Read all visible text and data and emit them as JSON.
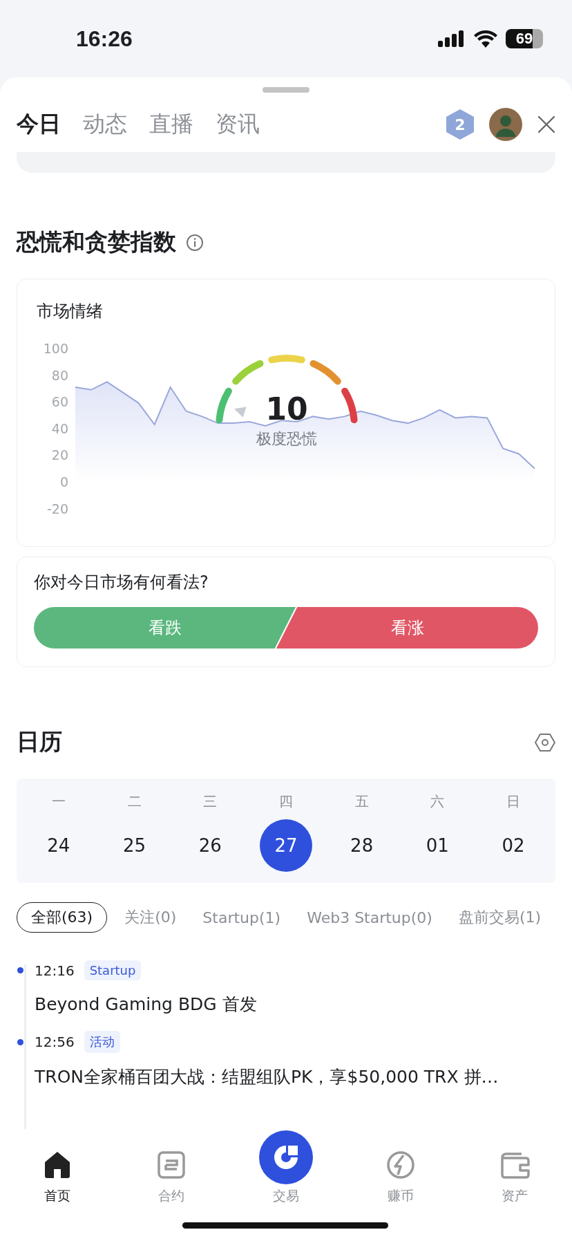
{
  "status_bar": {
    "time": "16:26",
    "battery": "69"
  },
  "tabs": [
    {
      "label": "今日",
      "selected": true
    },
    {
      "label": "动态",
      "selected": false
    },
    {
      "label": "直播",
      "selected": false
    },
    {
      "label": "资讯",
      "selected": false
    }
  ],
  "header": {
    "level_badge": "2"
  },
  "fear_greed": {
    "title": "恐慌和贪婪指数",
    "card_title": "市场情绪",
    "gauge": {
      "value": "10",
      "label": "极度恐慌"
    },
    "chart_data": {
      "type": "area",
      "ylim": [
        -20,
        100
      ],
      "yticks": [
        100,
        80,
        60,
        40,
        20,
        0,
        -20
      ],
      "series": [
        {
          "color": "#9aa8dc",
          "values": [
            71,
            69,
            75,
            67,
            59,
            43,
            71,
            53,
            49,
            44,
            44,
            45,
            42,
            46,
            45,
            49,
            47,
            49,
            53,
            50,
            46,
            44,
            48,
            54,
            48,
            49,
            48,
            25,
            21,
            10
          ]
        }
      ]
    }
  },
  "poll": {
    "question": "你对今日市场有何看法?",
    "options": [
      {
        "label": "看跌",
        "kind": "down"
      },
      {
        "label": "看涨",
        "kind": "up"
      }
    ]
  },
  "calendar": {
    "title": "日历",
    "days": [
      {
        "weekday": "一",
        "date": "24",
        "selected": false
      },
      {
        "weekday": "二",
        "date": "25",
        "selected": false
      },
      {
        "weekday": "三",
        "date": "26",
        "selected": false
      },
      {
        "weekday": "四",
        "date": "27",
        "selected": true
      },
      {
        "weekday": "五",
        "date": "28",
        "selected": false
      },
      {
        "weekday": "六",
        "date": "01",
        "selected": false
      },
      {
        "weekday": "日",
        "date": "02",
        "selected": false
      }
    ]
  },
  "filters": [
    {
      "label": "全部(63)",
      "selected": true
    },
    {
      "label": "关注(0)",
      "selected": false
    },
    {
      "label": "Startup(1)",
      "selected": false
    },
    {
      "label": "Web3 Startup(0)",
      "selected": false
    },
    {
      "label": "盘前交易(1)",
      "selected": false
    }
  ],
  "events": [
    {
      "time": "12:16",
      "tag": "Startup",
      "title": "Beyond Gaming BDG 首发"
    },
    {
      "time": "12:56",
      "tag": "活动",
      "title": "TRON全家桶百团大战：结盟组队PK，享$50,000 TRX 拼…"
    }
  ],
  "nav": [
    {
      "label": "首页",
      "kind": "home",
      "selected": true
    },
    {
      "label": "合约",
      "kind": "contract",
      "selected": false
    },
    {
      "label": "交易",
      "kind": "trade",
      "selected": false
    },
    {
      "label": "赚币",
      "kind": "earn",
      "selected": false
    },
    {
      "label": "资产",
      "kind": "assets",
      "selected": false
    }
  ]
}
